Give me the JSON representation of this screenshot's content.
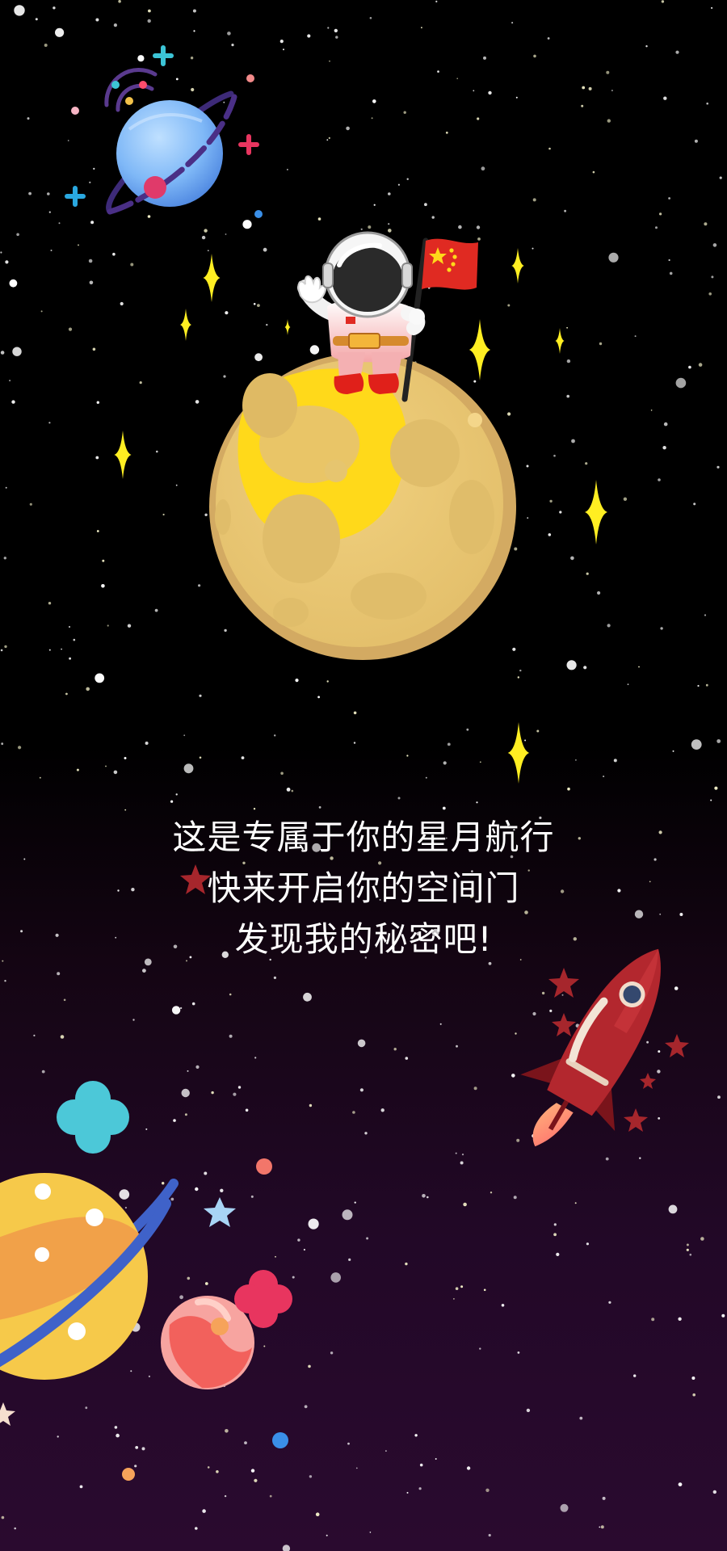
{
  "poster": {
    "caption_lines": [
      "这是专属于你的星月航行",
      "快来开启你的空间门",
      "发现我的秘密吧!"
    ]
  },
  "palette": {
    "sky_top": "#000000",
    "sky_bottom": "#2a0a2f",
    "moon": "#e8c675",
    "moon_highlight": "#ffd91a",
    "sparkle": "#ffee22",
    "rocket": "#a8232a",
    "flag": "#e02a22"
  },
  "icons": [
    "blue-ringed-planet-icon",
    "moon-icon",
    "astronaut-icon",
    "flag-icon",
    "rocket-icon",
    "yellow-ringed-planet-icon",
    "pink-planet-icon",
    "cyan-clover-icon",
    "pink-clover-icon",
    "sparkle-star-icon"
  ]
}
